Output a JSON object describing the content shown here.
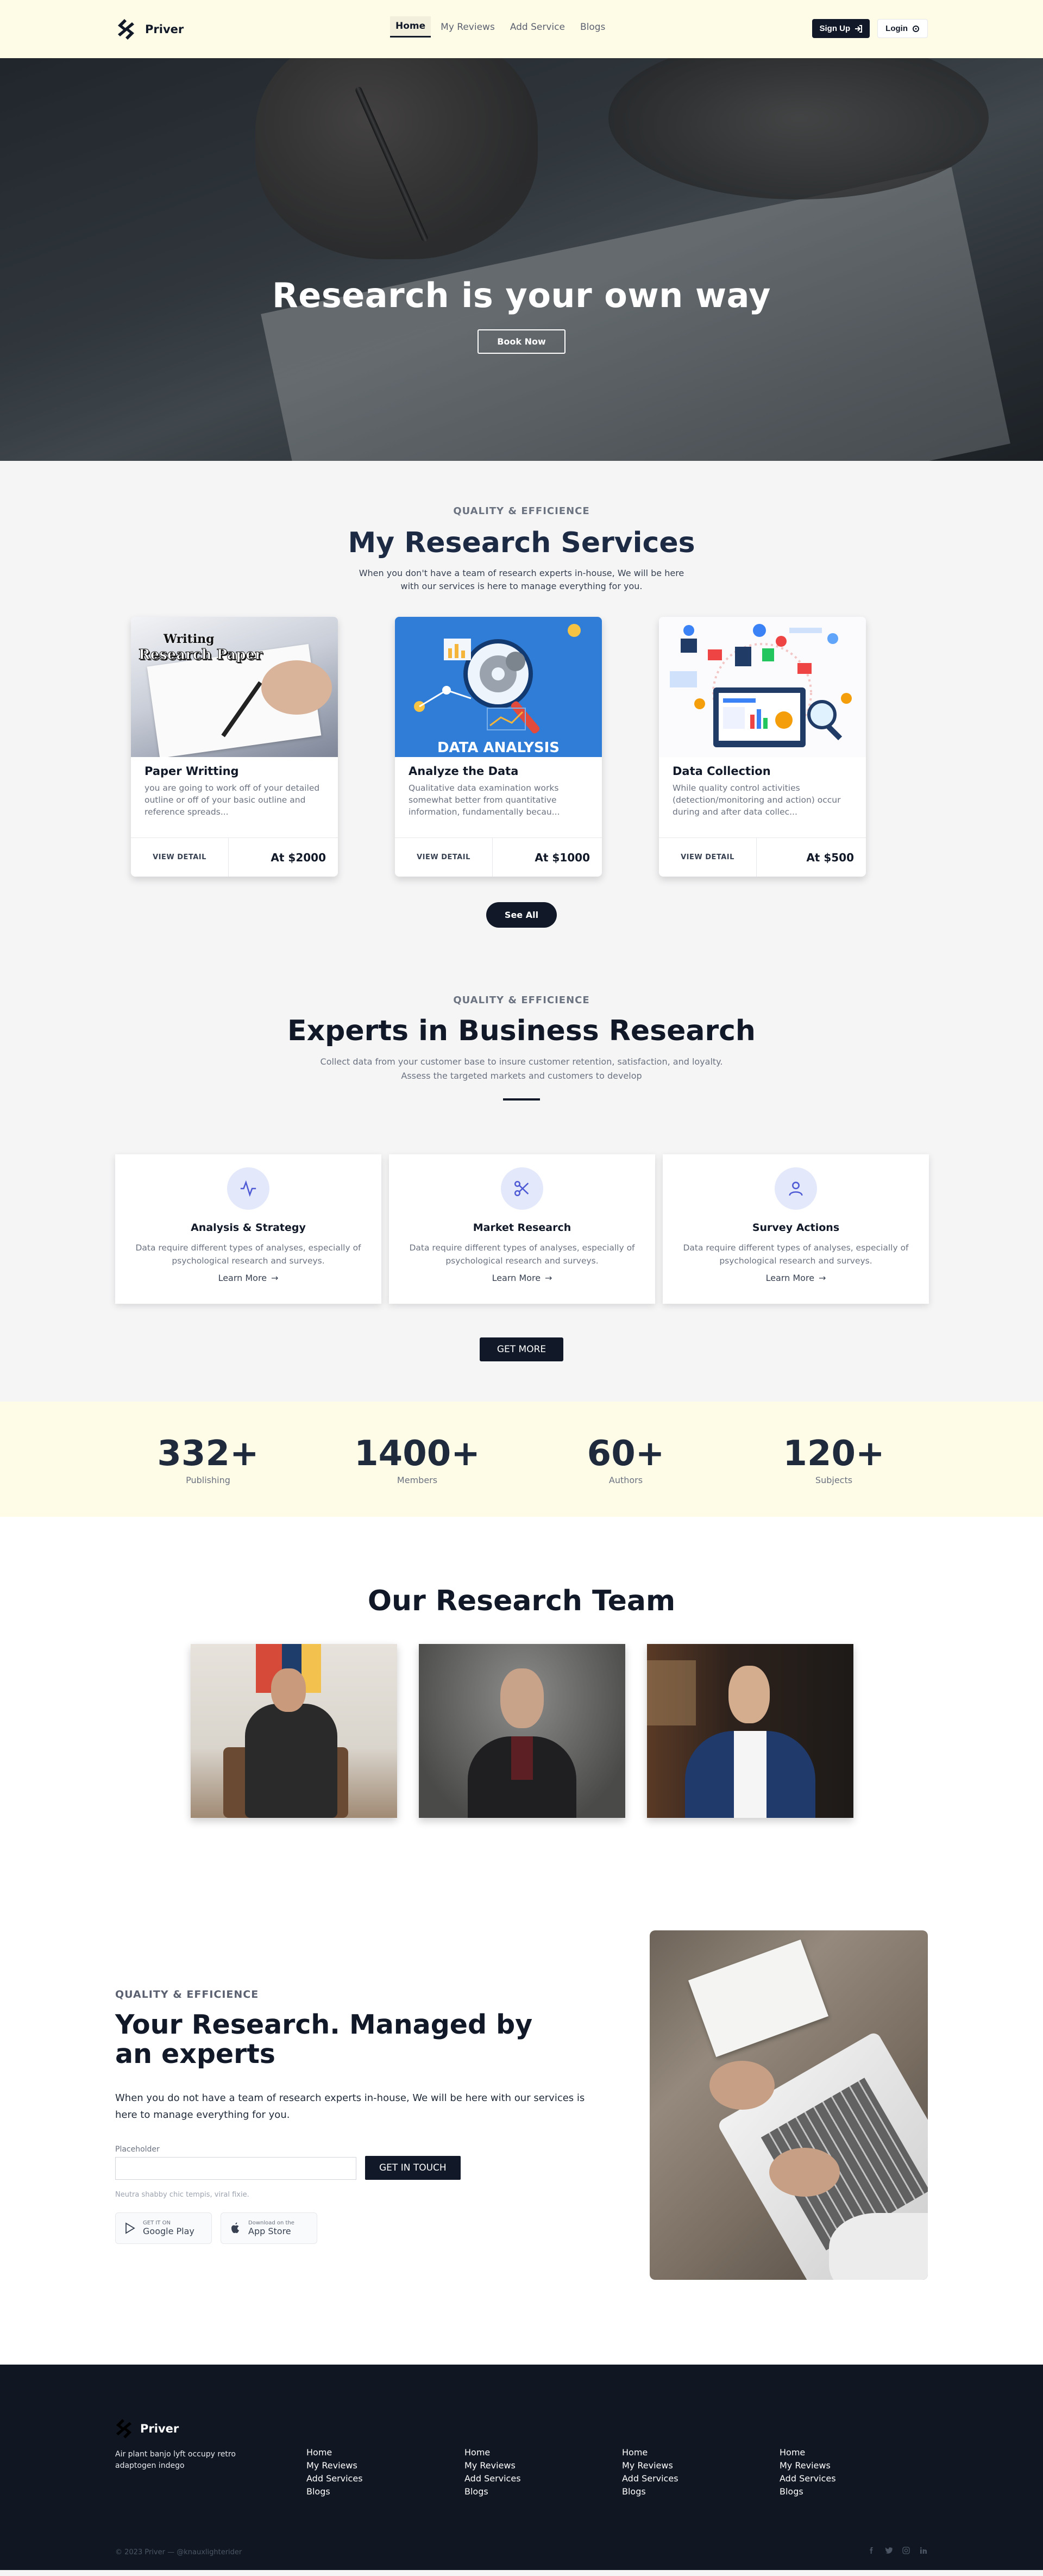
{
  "header": {
    "brand": "Priver",
    "nav": [
      {
        "label": "Home",
        "active": true
      },
      {
        "label": "My Reviews"
      },
      {
        "label": "Add Service"
      },
      {
        "label": "Blogs"
      }
    ],
    "signup_label": "Sign Up",
    "login_label": "Login"
  },
  "hero": {
    "title": "Research is your own way",
    "button": "Book Now"
  },
  "services": {
    "label": "QUALITY & EFFICIENCE",
    "title": "My Research Services",
    "subtitle": "When you don't have a team of research experts in-house, We will be here with our services is here to manage everything for you.",
    "cards": [
      {
        "image_text": [
          "Writing",
          "Research Paper"
        ],
        "title": "Paper Writting",
        "desc": "you are going to work off of your detailed outline or off of your basic outline and reference spreads...",
        "button": "VIEW DETAIL",
        "price": "At $2000"
      },
      {
        "image_text": [
          "DATA ANALYSIS"
        ],
        "title": "Analyze the Data",
        "desc": "Qualitative data examination works somewhat better from quantitative information, fundamentally becau...",
        "button": "VIEW DETAIL",
        "price": "At $1000"
      },
      {
        "image_text": [],
        "title": "Data Collection",
        "desc": "While quality control activities (detection/monitoring and action) occur during and after data collec...",
        "button": "VIEW DETAIL",
        "price": "At $500"
      }
    ],
    "see_all": "See All"
  },
  "experts": {
    "label": "QUALITY & EFFICIENCE",
    "title": "Experts in Business Research",
    "subtitle": "Collect data from your customer base to insure customer retention, satisfaction, and loyalty. Assess the targeted markets and customers to develop",
    "cards": [
      {
        "icon": "activity-icon",
        "title": "Analysis & Strategy",
        "desc": "Data require different types of analyses, especially of psychological research and surveys.",
        "link": "Learn More"
      },
      {
        "icon": "scissors-icon",
        "title": "Market Research",
        "desc": "Data require different types of analyses, especially of psychological research and surveys.",
        "link": "Learn More"
      },
      {
        "icon": "user-icon",
        "title": "Survey Actions",
        "desc": "Data require different types of analyses, especially of psychological research and surveys.",
        "link": "Learn More"
      }
    ],
    "button": "GET MORE"
  },
  "stats": [
    {
      "value": "332+",
      "label": "Publishing"
    },
    {
      "value": "1400+",
      "label": "Members"
    },
    {
      "value": "60+",
      "label": "Authors"
    },
    {
      "value": "120+",
      "label": "Subjects"
    }
  ],
  "team": {
    "title": "Our Research Team"
  },
  "managed": {
    "label": "QUALITY & EFFICIENCE",
    "title": "Your Research. Managed by an experts",
    "desc": "When you do not have a team of research experts in-house, We will be here with our services is here to manage everything for you.",
    "input_label": "Placeholder",
    "button": "GET IN TOUCH",
    "help": "Neutra shabby chic tempis, viral fixie.",
    "stores": [
      {
        "small": "GET IT ON",
        "name": "Google Play",
        "icon": "play-icon"
      },
      {
        "small": "Download on the",
        "name": "App Store",
        "icon": "apple-icon"
      }
    ]
  },
  "footer": {
    "brand": "Priver",
    "desc": "Air plant banjo lyft occupy retro adaptogen indego",
    "columns": [
      [
        "Home",
        "My Reviews",
        "Add Services",
        "Blogs"
      ],
      [
        "Home",
        "My Reviews",
        "Add Services",
        "Blogs"
      ],
      [
        "Home",
        "My Reviews",
        "Add Services",
        "Blogs"
      ],
      [
        "Home",
        "My Reviews",
        "Add Services",
        "Blogs"
      ]
    ],
    "copyright": "© 2023 Priver —",
    "handle": "@knauxlighterider",
    "social": [
      "facebook-icon",
      "twitter-icon",
      "instagram-icon",
      "linkedin-icon"
    ]
  }
}
